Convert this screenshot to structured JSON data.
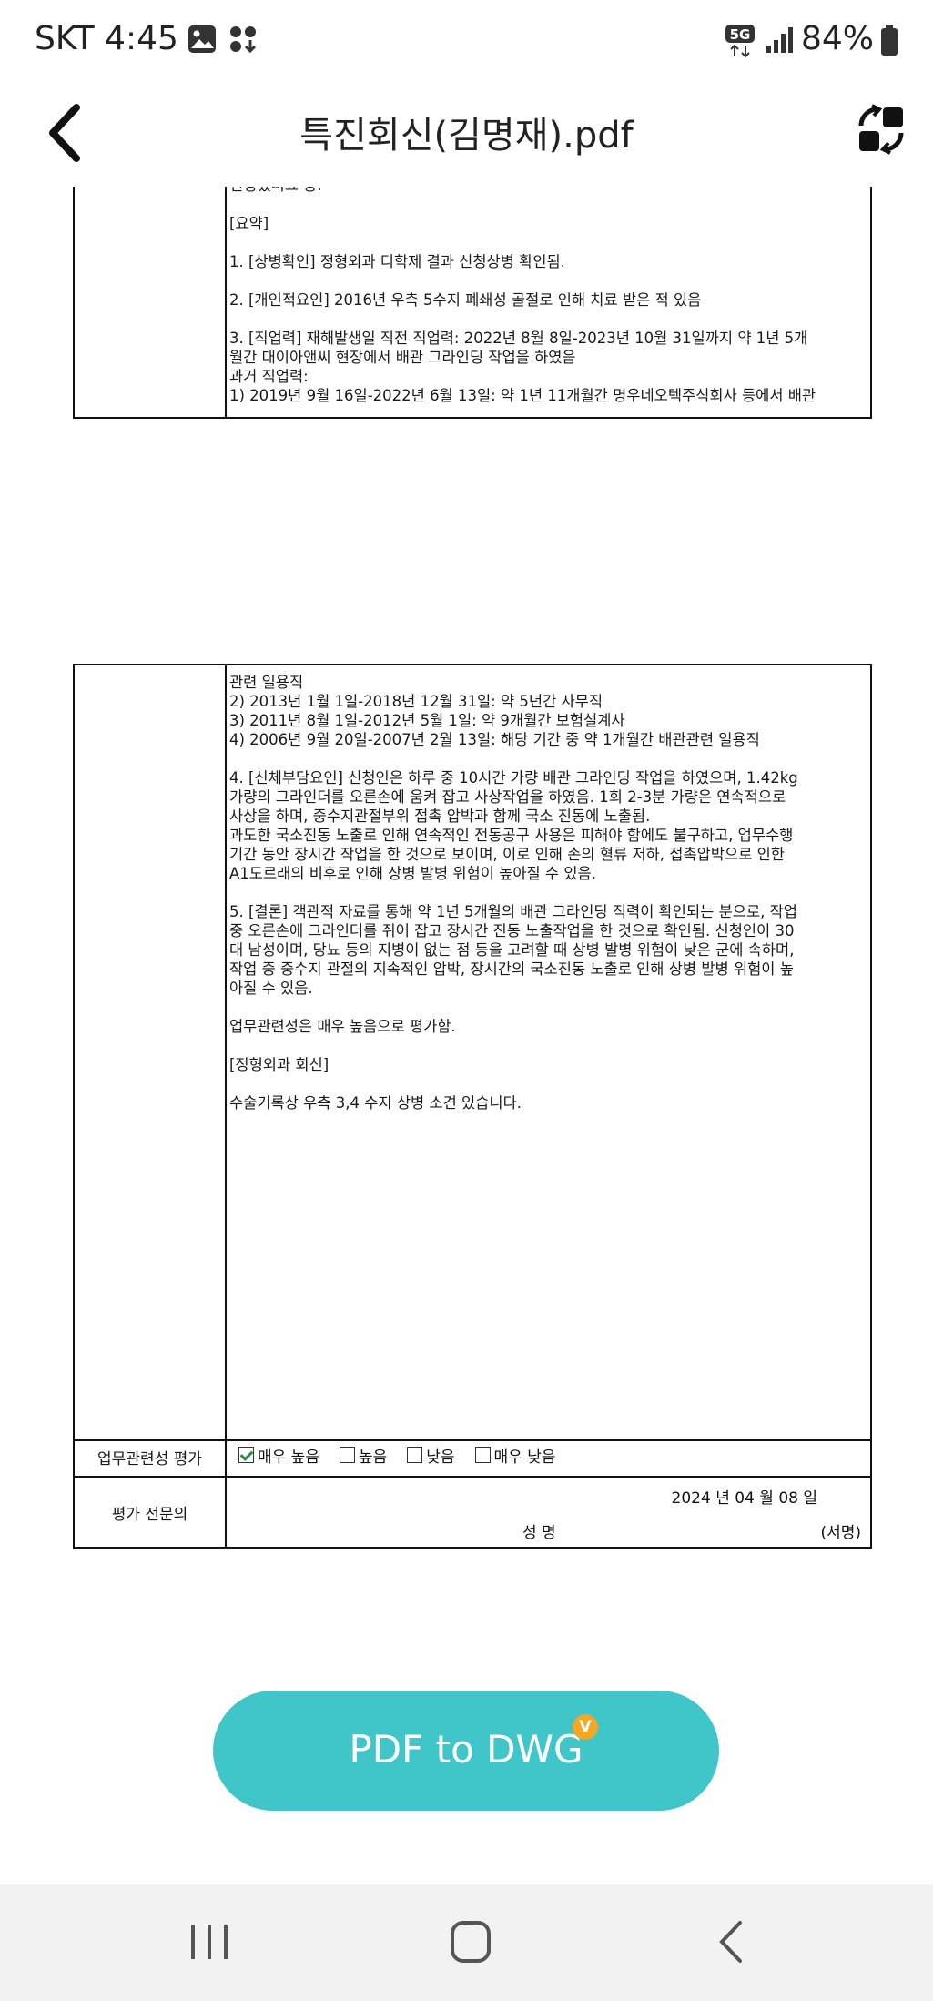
{
  "status_bar": {
    "carrier_time": "SKT 4:45",
    "network": "5G",
    "battery": "84%"
  },
  "header": {
    "title": "특진회신(김명재).pdf",
    "back_icon": "chevron-left-icon",
    "convert_icon": "convert-icon"
  },
  "page1": {
    "lines": [
      "신청했더요 등.",
      "",
      "[요약]",
      "",
      "1. [상병확인] 정형외과 디학제 결과 신청상병 확인됨.",
      "",
      "2. [개인적요인] 2016년 우측 5수지 폐쇄성 골절로 인해 치료 받은 적 있음",
      "",
      "3. [직업력] 재해발생일 직전 직업력: 2022년 8월 8일-2023년 10월 31일까지 약 1년 5개",
      "월간 대이아앤씨 현장에서 배관 그라인딩 작업을 하였음",
      "과거 직업력:",
      "1) 2019년 9월 16일-2022년 6월 13일: 약 1년 11개월간 명우네오텍주식회사 등에서 배관"
    ]
  },
  "page2": {
    "lines": [
      "관련 일용직",
      "2) 2013년 1월 1일-2018년 12월 31일: 약 5년간 사무직",
      "3) 2011년 8월 1일-2012년 5월 1일: 약 9개월간 보험설계사",
      "4) 2006년 9월 20일-2007년 2월 13일: 해당 기간 중 약 1개월간 배관관련 일용직",
      "",
      "4. [신체부담요인] 신청인은 하루 중 10시간 가량 배관 그라인딩 작업을 하였으며, 1.42kg",
      "가량의 그라인더를 오른손에 움켜 잡고 사상작업을 하였음. 1회 2-3분 가량은 연속적으로",
      "사상을 하며, 중수지관절부위 접촉 압박과 함께 국소 진동에 노출됨.",
      "과도한 국소진동 노출로 인해 연속적인 전동공구 사용은 피해야 함에도 불구하고, 업무수행",
      "기간 동안 장시간 작업을 한 것으로 보이며, 이로 인해 손의 혈류 저하, 접촉압박으로 인한",
      "A1도르래의 비후로 인해 상병 발병 위험이 높아질 수 있음.",
      "",
      "5. [결론] 객관적 자료를 통해 약 1년 5개월의 배관 그라인딩 직력이 확인되는 분으로, 작업",
      "중 오른손에 그라인더를 쥐어 잡고 장시간 진동 노출작업을 한 것으로 확인됨. 신청인이 30",
      "대 남성이며, 당뇨 등의 지병이 없는 점 등을 고려할 때 상병 발병 위험이 낮은 군에 속하며,",
      "작업 중 중수지 관절의 지속적인 압박, 장시간의 국소진동 노출로 인해 상병 발병 위험이 높",
      "아질 수 있음.",
      "",
      "업무관련성은 매우 높음으로 평가함.",
      "",
      "[정형외과 회신]",
      "",
      "수술기록상 우측 3,4 수지 상병 소견 있습니다."
    ],
    "eval_label": "업무관련성 평가",
    "options": [
      {
        "label": "매우 높음",
        "checked": true
      },
      {
        "label": "높음",
        "checked": false
      },
      {
        "label": "낮음",
        "checked": false
      },
      {
        "label": "매우 낮음",
        "checked": false
      }
    ],
    "expert_label": "평가 전문의",
    "date": "2024 년  04 월  08 일",
    "sign_label": "성 명",
    "sign_mark": "(서명)"
  },
  "action": {
    "button_label": "PDF to DWG",
    "badge": "V"
  },
  "nav": {
    "recents_icon": "recents-icon",
    "home_icon": "home-icon",
    "back_icon": "back-icon"
  },
  "colors": {
    "accent": "#40c6c9",
    "badge": "#f5a623",
    "check": "#2e8b3a"
  }
}
